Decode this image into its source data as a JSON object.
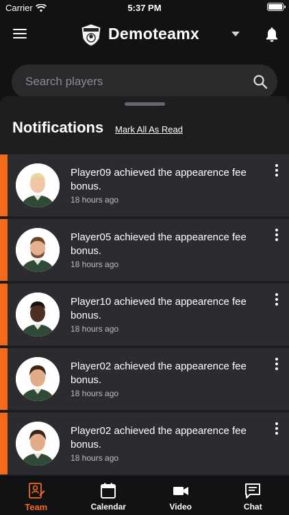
{
  "status_bar": {
    "carrier": "Carrier",
    "time": "5:37 PM"
  },
  "header": {
    "team_name": "Demoteamx"
  },
  "search": {
    "placeholder": "Search players"
  },
  "notifications": {
    "title": "Notifications",
    "mark_all_label": "Mark All As Read",
    "items": [
      {
        "message": "Player09 achieved the appearence fee bonus.",
        "time": "18 hours ago",
        "unread": true
      },
      {
        "message": "Player05 achieved the appearence fee bonus.",
        "time": "18 hours ago",
        "unread": true
      },
      {
        "message": "Player10 achieved the appearence fee bonus.",
        "time": "18 hours ago",
        "unread": true
      },
      {
        "message": "Player02 achieved the appearence fee bonus.",
        "time": "18 hours ago",
        "unread": true
      },
      {
        "message": "Player02 achieved the appearence fee bonus.",
        "time": "18 hours ago",
        "unread": true
      }
    ]
  },
  "tabs": [
    {
      "label": "Team",
      "icon": "team-icon",
      "active": true
    },
    {
      "label": "Calendar",
      "icon": "calendar-icon",
      "active": false
    },
    {
      "label": "Video",
      "icon": "video-icon",
      "active": false
    },
    {
      "label": "Chat",
      "icon": "chat-icon",
      "active": false
    }
  ],
  "colors": {
    "accent": "#f26b1d",
    "background": "#111214",
    "card": "#2c2c30",
    "sheet": "#1e1e21"
  }
}
